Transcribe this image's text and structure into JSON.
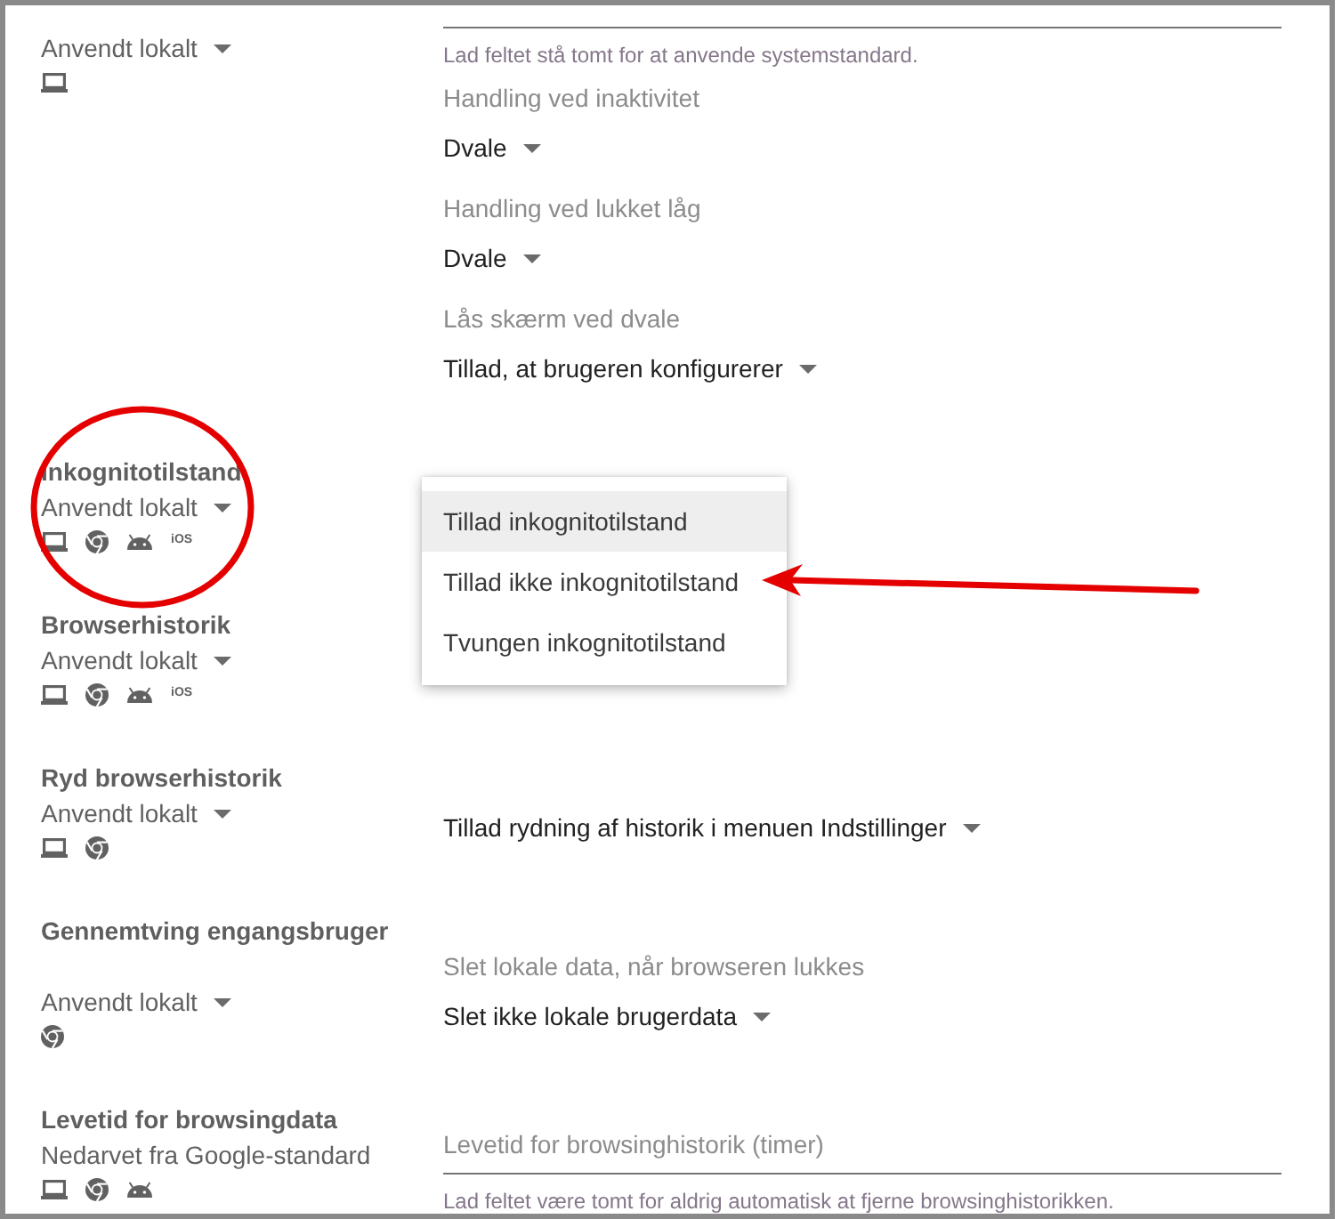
{
  "settings": [
    {
      "circled": false,
      "status": {
        "text": "Anvendt lokalt",
        "dropdown": true
      },
      "platforms": [
        {
          "kind": "laptop"
        }
      ],
      "fields": [
        {
          "kind": "text_field",
          "helper": "Lad feltet stå tomt for at anvende systemstandard."
        },
        {
          "kind": "select",
          "label": "Handling ved inaktivitet",
          "value": "Dvale"
        },
        {
          "kind": "select",
          "label": "Handling ved lukket låg",
          "value": "Dvale"
        },
        {
          "kind": "select",
          "label": "Lås skærm ved dvale",
          "value": "Tillad, at brugeren konfigurerer"
        }
      ]
    },
    {
      "title": "Inkognitotilstand",
      "circled": true,
      "status": {
        "text": "Anvendt lokalt",
        "dropdown": true
      },
      "platforms": [
        {
          "kind": "laptop"
        },
        {
          "kind": "chrome"
        },
        {
          "kind": "android"
        },
        {
          "kind": "ios",
          "label": "iOS"
        }
      ],
      "menu": {
        "items": [
          {
            "label": "Tillad inkognitotilstand",
            "selected": true,
            "arrow": false
          },
          {
            "label": "Tillad ikke inkognitotilstand",
            "selected": false,
            "arrow": true
          },
          {
            "label": "Tvungen inkognitotilstand",
            "selected": false,
            "arrow": false
          }
        ]
      }
    },
    {
      "title": "Browserhistorik",
      "circled": false,
      "status": {
        "text": "Anvendt lokalt",
        "dropdown": true
      },
      "platforms": [
        {
          "kind": "laptop"
        },
        {
          "kind": "chrome"
        },
        {
          "kind": "android"
        },
        {
          "kind": "ios",
          "label": "iOS"
        }
      ]
    },
    {
      "title": "Ryd browserhistorik",
      "circled": false,
      "status": {
        "text": "Anvendt lokalt",
        "dropdown": true
      },
      "platforms": [
        {
          "kind": "laptop"
        },
        {
          "kind": "chrome"
        }
      ],
      "fields": [
        {
          "kind": "select",
          "value": "Tillad rydning af historik i menuen Indstillinger"
        }
      ]
    },
    {
      "title": "Gennemtving engangsbruger",
      "circled": false,
      "status": {
        "text": "Anvendt lokalt",
        "dropdown": true
      },
      "platforms": [
        {
          "kind": "chrome"
        }
      ],
      "fields": [
        {
          "kind": "select",
          "label": "Slet lokale data, når browseren lukkes",
          "value": "Slet ikke lokale brugerdata"
        }
      ]
    },
    {
      "title": "Levetid for browsingdata",
      "circled": false,
      "status": {
        "text": "Nedarvet fra Google-standard",
        "dropdown": false
      },
      "platforms": [
        {
          "kind": "laptop"
        },
        {
          "kind": "chrome"
        },
        {
          "kind": "android"
        }
      ],
      "fields": [
        {
          "kind": "text_field",
          "placeholder": "Levetid for browsinghistorik (timer)",
          "helper": "Lad feltet være tomt for aldrig automatisk at fjerne browsinghistorikken."
        }
      ]
    }
  ]
}
